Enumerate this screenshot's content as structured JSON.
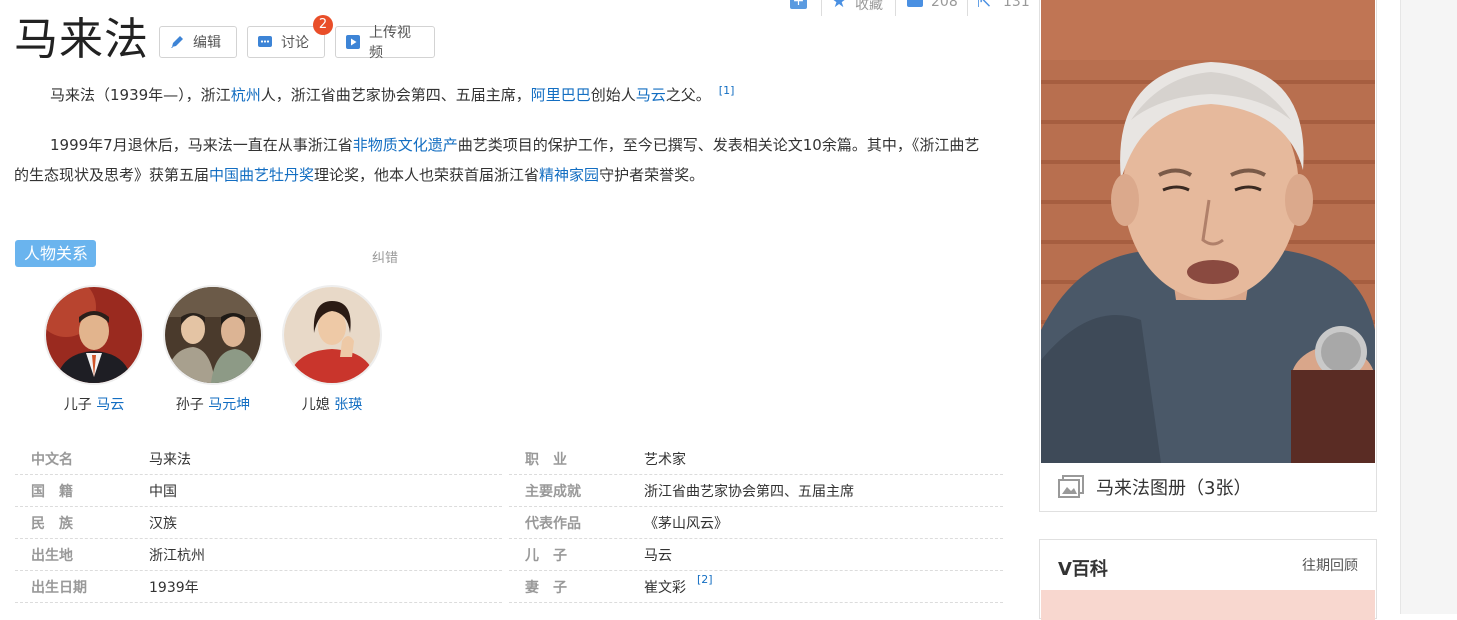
{
  "topbar": {
    "collect_label": "收藏",
    "like_count": "208",
    "share_count": "131"
  },
  "title": "马来法",
  "toolbar": {
    "edit_label": "编辑",
    "discuss_label": "讨论",
    "discuss_badge": "2",
    "upload_label": "上传视频"
  },
  "intro": {
    "p1": {
      "a": "马来法（1939年—），浙江",
      "l1": "杭州",
      "b": "人，浙江省曲艺家协会第四、五届主席，",
      "l2": "阿里巴巴",
      "c": "创始人",
      "l3": "马云",
      "d": "之父。",
      "ref": "[1]"
    },
    "p2": {
      "a": "1999年7月退休后，马来法一直在从事浙江省",
      "l1": "非物质文化遗产",
      "b": "曲艺类项目的保护工作，至今已撰写、发表相关论文10余篇。其中，《浙江曲艺的生态现状及思考》获第五届",
      "l2": "中国曲艺牡丹奖",
      "c": "理论奖，他本人也荣获首届浙江省",
      "l3": "精神家园",
      "d": "守护者荣誉奖。"
    }
  },
  "relations": {
    "tag": "人物关系",
    "correction": "纠错",
    "people": [
      {
        "relation": "儿子",
        "name": "马云"
      },
      {
        "relation": "孙子",
        "name": "马元坤"
      },
      {
        "relation": "儿媳",
        "name": "张瑛"
      }
    ]
  },
  "info": {
    "left": [
      {
        "key": "中文名",
        "value": "马来法"
      },
      {
        "key": "国　籍",
        "value": "中国"
      },
      {
        "key": "民　族",
        "value": "汉族"
      },
      {
        "key": "出生地",
        "value": "浙江杭州"
      },
      {
        "key": "出生日期",
        "value": "1939年"
      }
    ],
    "right": [
      {
        "key": "职　业",
        "value": "艺术家",
        "link": true
      },
      {
        "key": "主要成就",
        "value": "浙江省曲艺家协会第四、五届主席"
      },
      {
        "key": "代表作品",
        "value": "《茅山风云》"
      },
      {
        "key": "儿　子",
        "value": "马云",
        "link": true
      },
      {
        "key": "妻　子",
        "value": "崔文彩",
        "link": true,
        "ref": "[2]"
      }
    ]
  },
  "sidebar": {
    "album_label": "马来法图册（3张）"
  },
  "vbaike": {
    "title": "V百科",
    "back_label": "往期回顾"
  },
  "colors": {
    "link": "#136ec2",
    "tag": "#6ab4ee",
    "badge": "#e94e29"
  }
}
